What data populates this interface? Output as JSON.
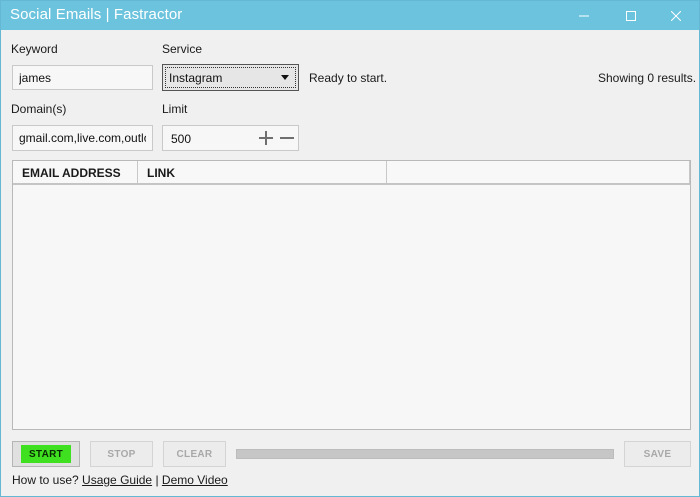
{
  "window": {
    "title": "Social Emails | Fastractor"
  },
  "form": {
    "keyword_label": "Keyword",
    "keyword_value": "james",
    "service_label": "Service",
    "service_selected": "Instagram",
    "domains_label": "Domain(s)",
    "domains_value": "gmail.com,live.com,outloo",
    "limit_label": "Limit",
    "limit_value": "500"
  },
  "status": {
    "state": "Ready to start.",
    "results": "Showing 0 results."
  },
  "table": {
    "columns": [
      "EMAIL ADDRESS",
      "LINK",
      ""
    ],
    "rows": []
  },
  "toolbar": {
    "start_label": "START",
    "stop_label": "STOP",
    "clear_label": "CLEAR",
    "save_label": "SAVE",
    "progress": 0
  },
  "footer": {
    "prompt": "How to use?",
    "usage_guide": "Usage Guide",
    "separator": "|",
    "demo_video": "Demo Video"
  },
  "colors": {
    "titlebar": "#6cc3dd",
    "start_button": "#3ee01f"
  },
  "icons": {
    "minimize": "minimize-icon",
    "maximize": "maximize-icon",
    "close": "close-icon",
    "dropdown": "chevron-down-icon",
    "increment": "plus-icon",
    "decrement": "minus-icon"
  }
}
